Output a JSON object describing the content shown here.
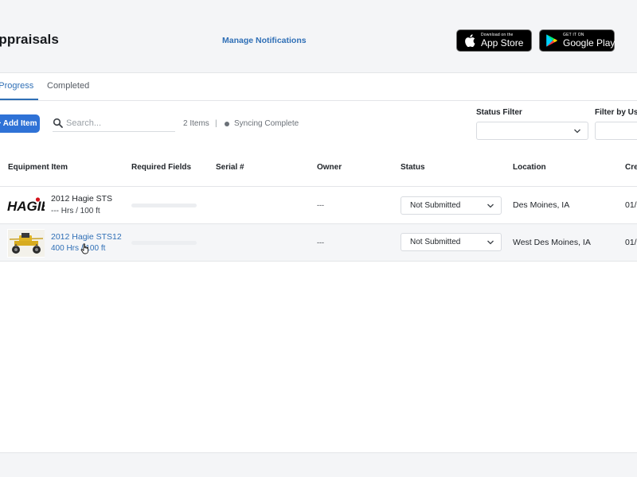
{
  "header": {
    "title": "Appraisals",
    "manage_notifications": "Manage Notifications",
    "app_store": {
      "small": "Download on the",
      "big": "App Store",
      "icon": "apple-icon"
    },
    "google_play": {
      "small": "GET IT ON",
      "big": "Google Play",
      "icon": "google-play-icon"
    }
  },
  "tabs": [
    {
      "label": "In Progress",
      "active": true
    },
    {
      "label": "Completed",
      "active": false
    }
  ],
  "toolbar": {
    "add_item": "+ Add Item",
    "search_placeholder": "Search...",
    "items_count": "2 Items",
    "separator": "|",
    "sync_status": "Syncing Complete"
  },
  "filters": {
    "status_label": "Status Filter",
    "status_value": "",
    "user_label": "Filter by User",
    "user_value": ""
  },
  "table": {
    "columns": [
      "Equipment Item",
      "Required Fields",
      "Serial #",
      "Owner",
      "Status",
      "Location",
      "Created"
    ],
    "rows": [
      {
        "name": "2012 Hagie STS",
        "sub": "--- Hrs / 100 ft",
        "required_fields": "",
        "serial": "",
        "owner": "---",
        "status": "Not Submitted",
        "location": "Des Moines, IA",
        "created": "01/"
      },
      {
        "name": "2012 Hagie STS12",
        "sub": "400 Hrs / 100 ft",
        "required_fields": "",
        "serial": "",
        "owner": "---",
        "status": "Not Submitted",
        "location": "West Des Moines, IA",
        "created": "01/"
      }
    ]
  },
  "colors": {
    "accent": "#2f72d6",
    "link": "#2f6fb6",
    "header_bg": "#f4f5f7"
  }
}
